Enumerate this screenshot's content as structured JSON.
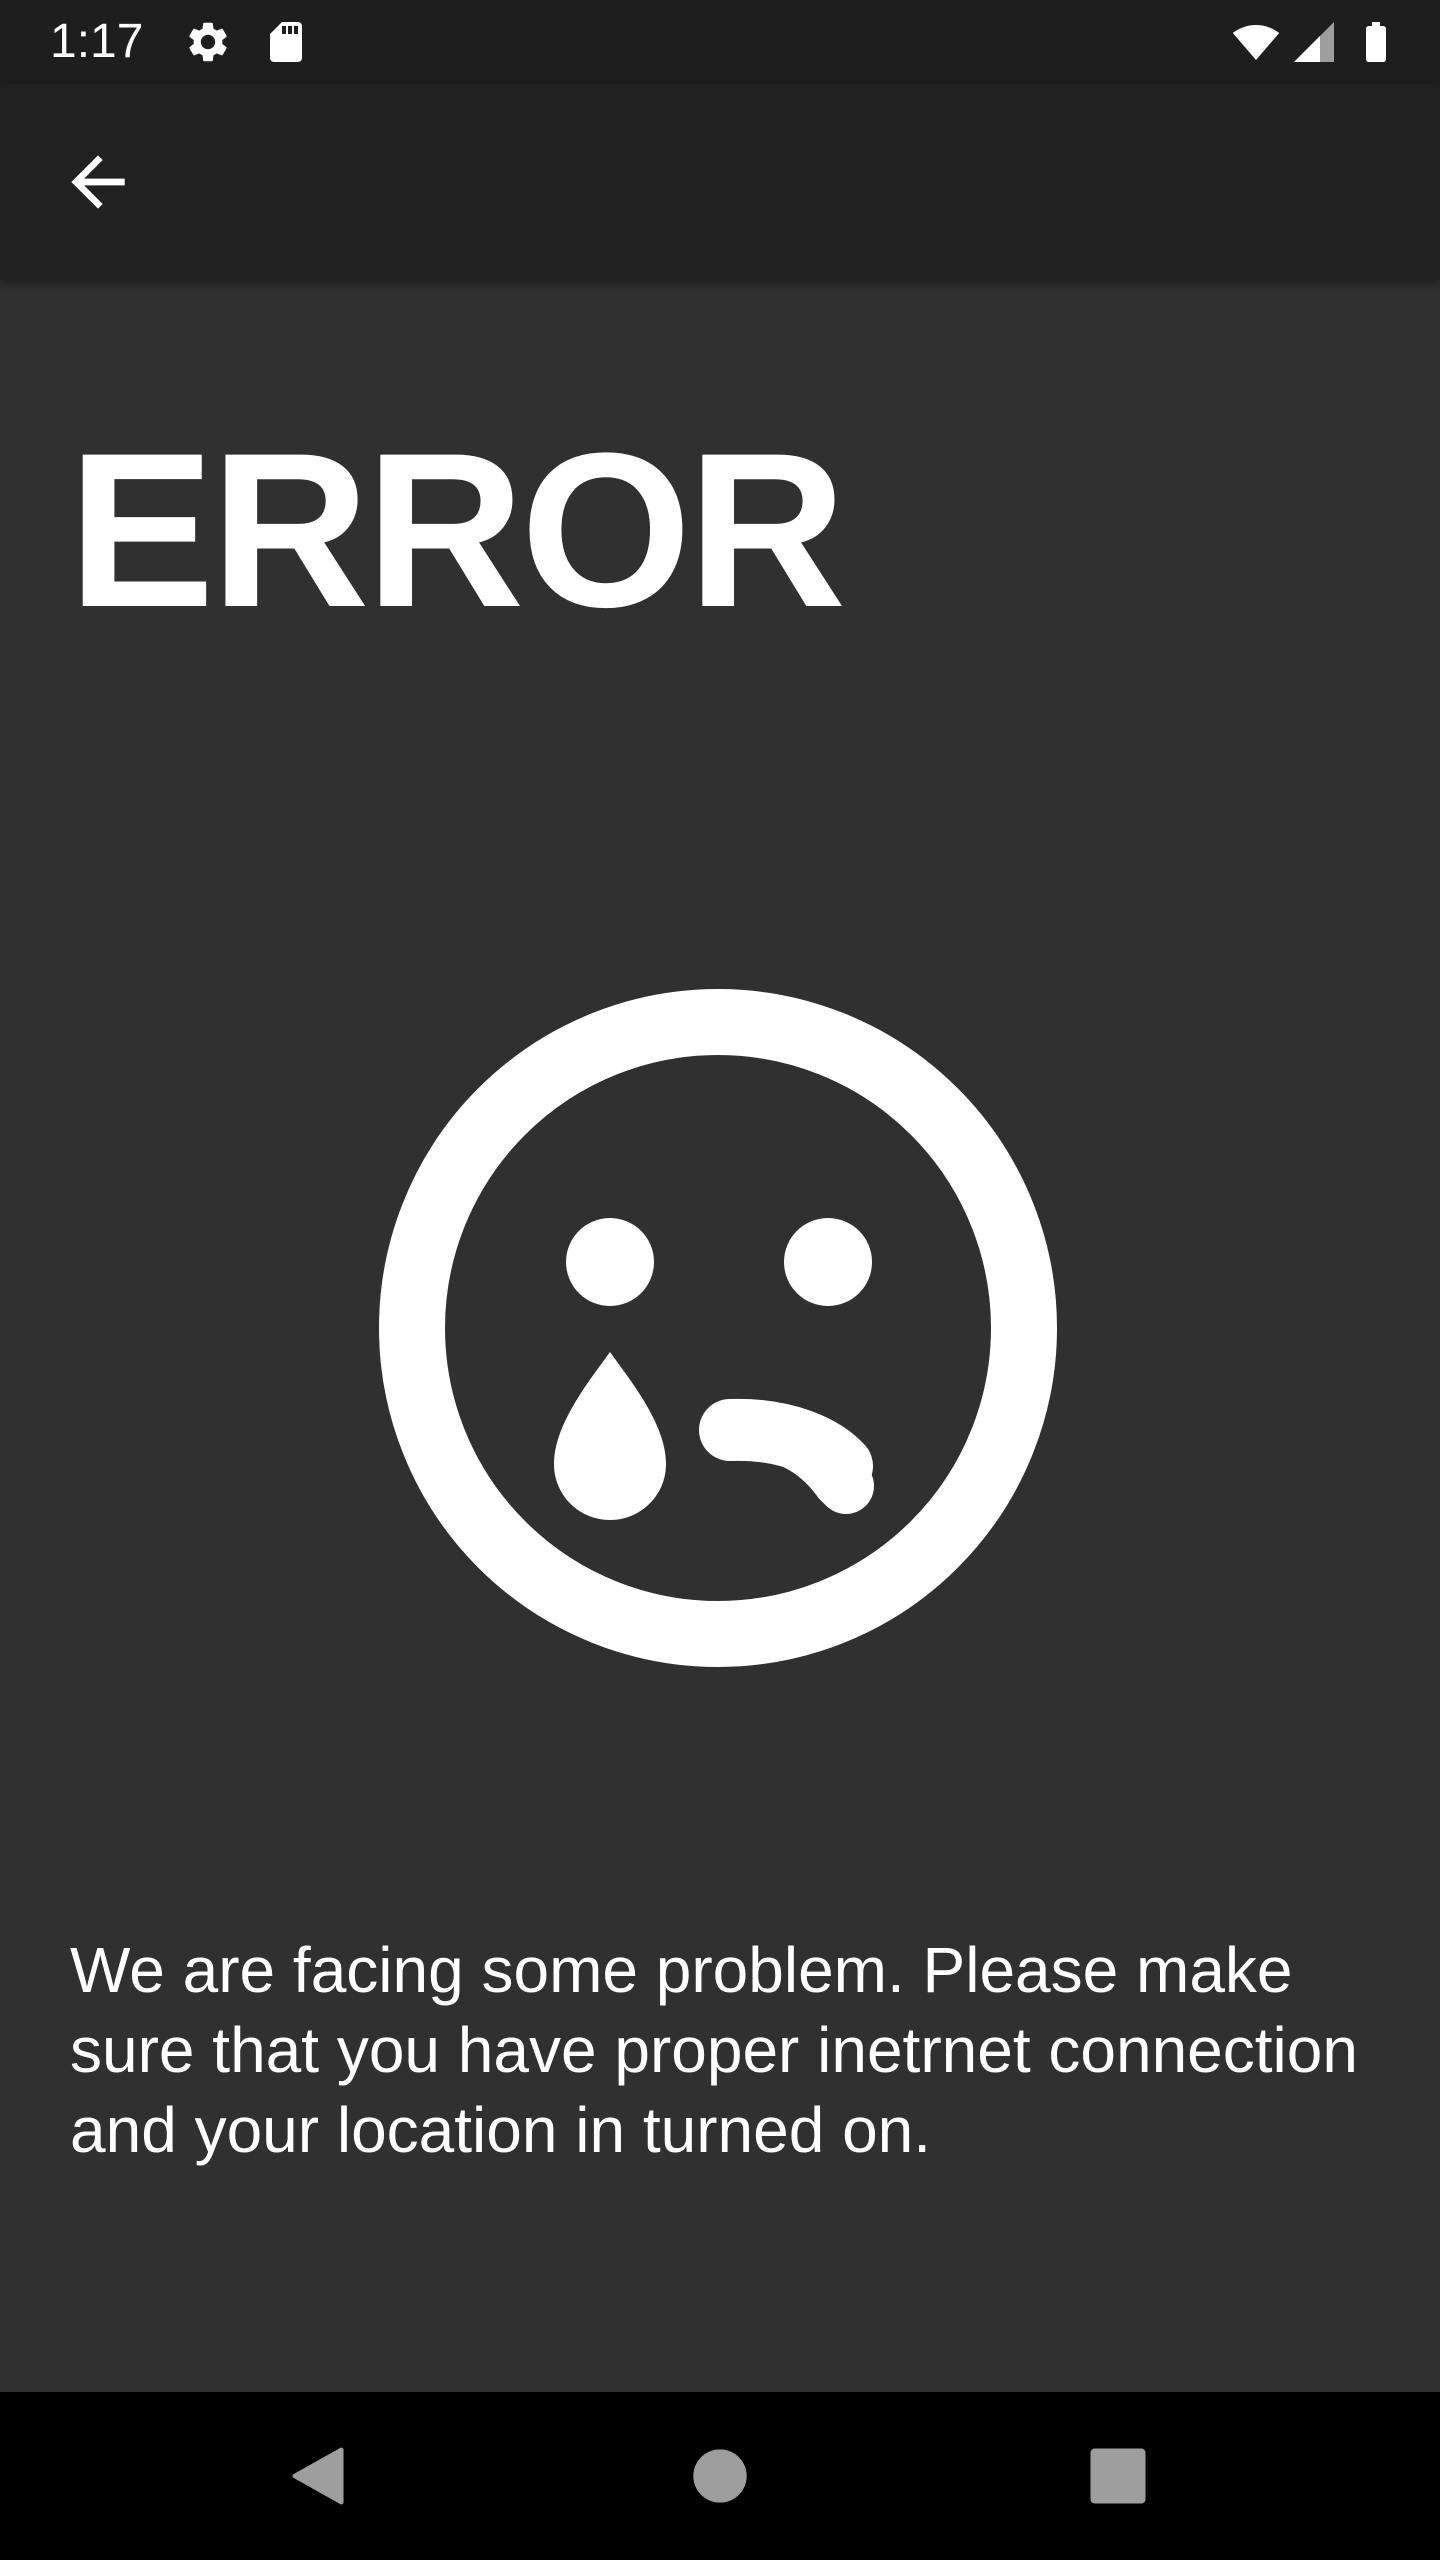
{
  "status_bar": {
    "time": "1:17",
    "icons": [
      "settings-icon",
      "sd-card-icon",
      "wifi-icon",
      "cell-signal-icon",
      "battery-icon"
    ]
  },
  "app_bar": {
    "back_icon": "arrow-back-icon"
  },
  "main": {
    "title": "ERROR",
    "illustration_icon": "sad-crying-face-icon",
    "message": "We are facing some problem. Please make sure that you have proper inetrnet connection and your location in turned on."
  },
  "nav_bar": {
    "icons": [
      "back-triangle-icon",
      "home-circle-icon",
      "recents-square-icon"
    ]
  },
  "colors": {
    "status_bar_bg": "#1e1e1e",
    "app_bar_bg": "#212121",
    "content_bg": "#303030",
    "nav_bar_bg": "#000000",
    "foreground": "#ffffff",
    "nav_icon": "#9e9e9e"
  }
}
